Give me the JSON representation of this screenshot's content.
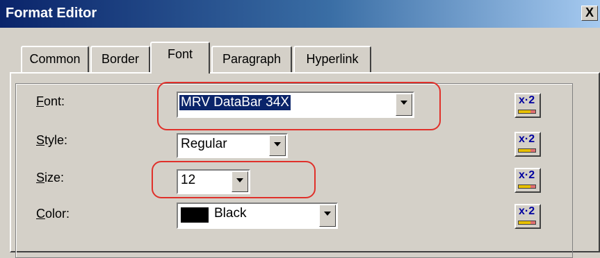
{
  "window": {
    "title": "Format Editor",
    "close_label": "X"
  },
  "tabs": [
    {
      "label": "Common"
    },
    {
      "label": "Border"
    },
    {
      "label": "Font",
      "active": true
    },
    {
      "label": "Paragraph"
    },
    {
      "label": "Hyperlink"
    }
  ],
  "fields": {
    "font": {
      "label": "Font:",
      "value": "MRV DataBar 34X"
    },
    "style": {
      "label": "Style:",
      "value": "Regular"
    },
    "size": {
      "label": "Size:",
      "value": "12"
    },
    "color": {
      "label": "Color:",
      "value": "Black",
      "swatch": "#000000"
    }
  },
  "expression_button_label": "x·2",
  "highlight_color": "#e0302a"
}
